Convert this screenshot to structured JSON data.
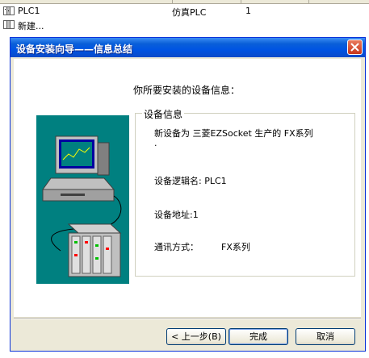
{
  "list": {
    "rows": [
      {
        "name": "PLC1",
        "driver": "仿真PLC",
        "address": "1",
        "icon": "plc-device-icon"
      },
      {
        "name": "新建...",
        "icon": "new-device-icon"
      }
    ]
  },
  "dialog": {
    "title": "设备安装向导——信息总结",
    "heading": "你所要安装的设备信息：",
    "group_title": "设备信息",
    "info_line1": "新设备为 三菱EZSocket 生产的 FX系列",
    "info_line1_cont": ".",
    "logical_name": "设备逻辑名: PLC1",
    "address": "设备地址:1",
    "comm_label": "通讯方式：",
    "comm_value": "FX系列",
    "buttons": {
      "back": "< 上一步(B)",
      "finish": "完成",
      "cancel": "取消"
    }
  },
  "colors": {
    "titlebar": "#0054e3",
    "illustration_bg": "#008080",
    "dialog_bg": "#ece9d8"
  }
}
